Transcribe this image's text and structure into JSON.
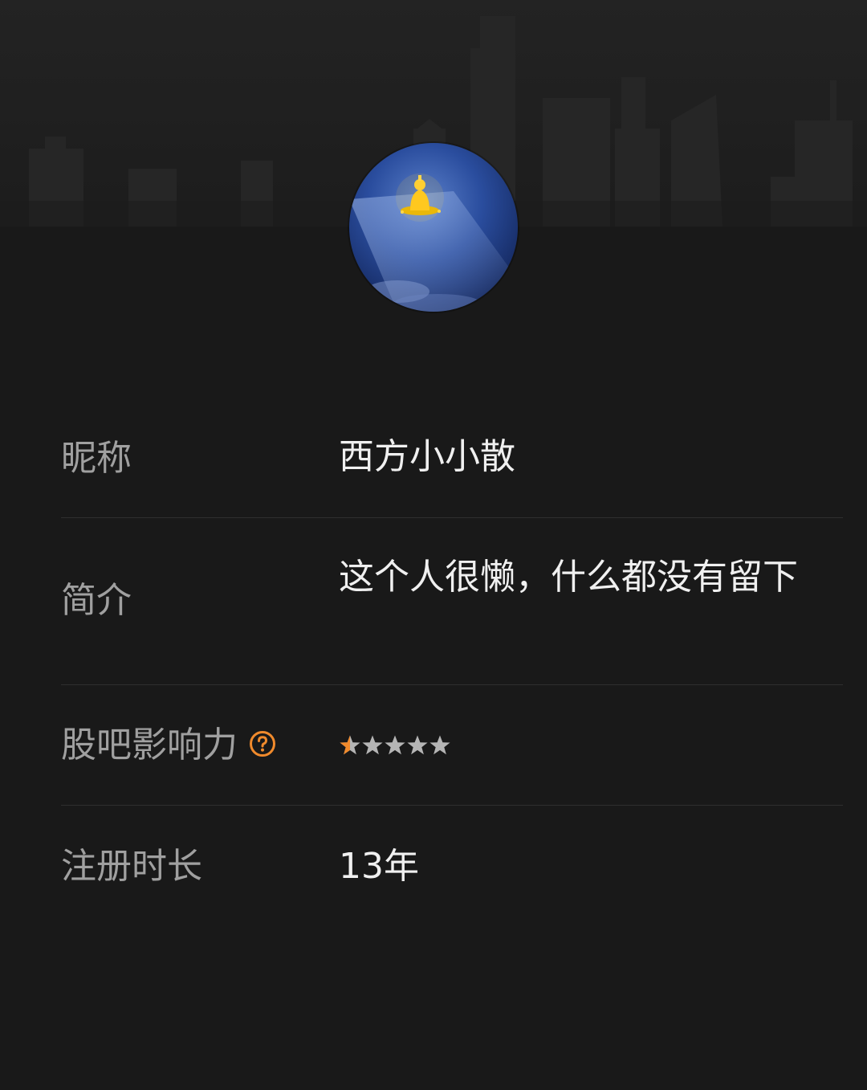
{
  "profile": {
    "avatar_icon": "buddha-statue-avatar"
  },
  "fields": {
    "nickname": {
      "label": "昵称",
      "value": "西方小小散"
    },
    "bio": {
      "label": "简介",
      "value": "这个人很懒，什么都没有留下"
    },
    "influence": {
      "label": "股吧影响力",
      "help_icon": "question-circle-icon",
      "rating": 1,
      "max_rating": 5,
      "star_active_color": "#f08a2c",
      "star_inactive_color": "#b5b5b5"
    },
    "registered": {
      "label": "注册时长",
      "value": "13年"
    }
  },
  "colors": {
    "background": "#191919",
    "label": "#a0a0a0",
    "value": "#f0f0f0",
    "accent": "#f08a2c",
    "divider": "#2f2f2f"
  }
}
